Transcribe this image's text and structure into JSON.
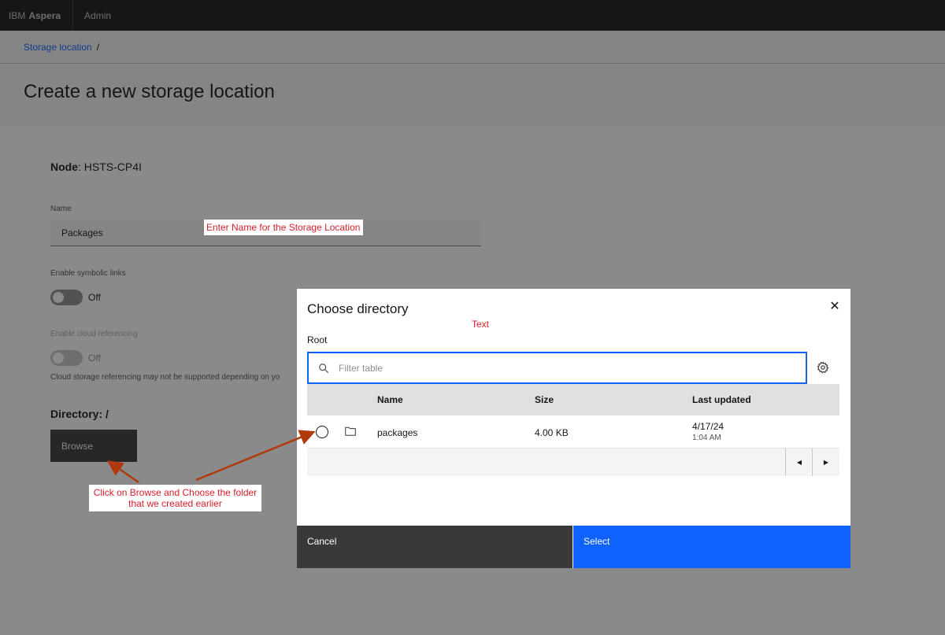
{
  "topbar": {
    "brand_prefix": "IBM",
    "brand_name": "Aspera",
    "nav_admin": "Admin"
  },
  "breadcrumb": {
    "link": "Storage location",
    "separator": "/"
  },
  "page": {
    "title": "Create a new storage location"
  },
  "form": {
    "node_label": "Node",
    "node_value": ": HSTS-CP4I",
    "name_label": "Name",
    "name_value": "Packages",
    "symlinks_label": "Enable symbolic links",
    "symlinks_state": "Off",
    "cloud_label": "Enable cloud referencing",
    "cloud_state": "Off",
    "cloud_helper": "Cloud storage referencing may not be supported depending on yo",
    "directory_label": "Directory",
    "directory_value": ": /",
    "browse_label": "Browse"
  },
  "annotations": {
    "name_callout": "Enter Name for the Storage Location",
    "browse_callout_line1": "Click on Browse and Choose the folder",
    "browse_callout_line2": "that we created  earlier",
    "text_label": "Text",
    "color": "#da1e28"
  },
  "modal": {
    "title": "Choose directory",
    "close_symbol": "✕",
    "root_label": "Root",
    "search_placeholder": "Filter table",
    "columns": {
      "name": "Name",
      "size": "Size",
      "last_updated": "Last updated"
    },
    "rows": [
      {
        "name": "packages",
        "size": "4.00 KB",
        "date": "4/17/24",
        "time": "1:04 AM"
      }
    ],
    "pager_prev": "◀",
    "pager_next": "▶",
    "cancel_label": "Cancel",
    "select_label": "Select"
  },
  "colors": {
    "accent": "#0f62fe",
    "topbar": "#161616",
    "button_dark": "#393939"
  },
  "icons": [
    "search-icon",
    "settings-icon",
    "folder-icon",
    "close-icon",
    "caret-left-icon",
    "caret-right-icon"
  ]
}
